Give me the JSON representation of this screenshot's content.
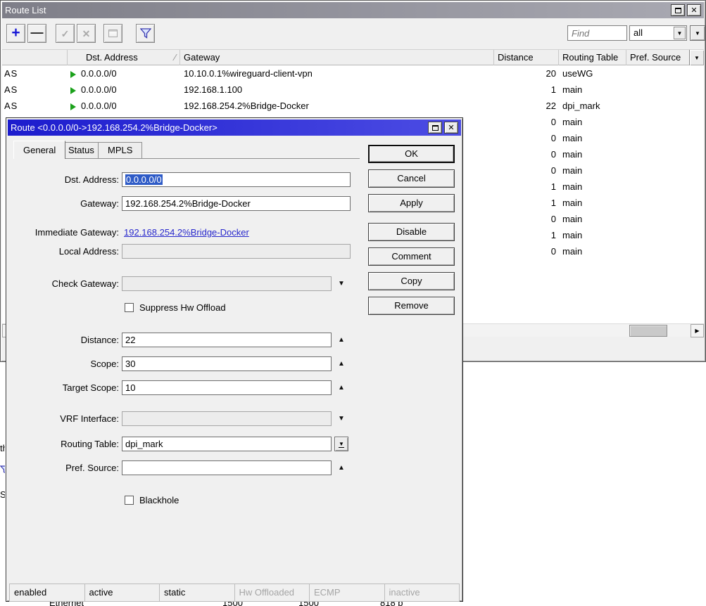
{
  "main_window": {
    "title": "Route List",
    "toolbar": {
      "find_placeholder": "Find",
      "scope_selected": "all"
    },
    "columns": {
      "dst_address": "Dst. Address",
      "gateway": "Gateway",
      "distance": "Distance",
      "routing_table": "Routing Table",
      "pref_source": "Pref. Source"
    },
    "rows": [
      {
        "flags": "AS",
        "dst": "0.0.0.0/0",
        "gateway": "10.10.0.1%wireguard-client-vpn",
        "distance": "20",
        "routing_table": "useWG"
      },
      {
        "flags": "AS",
        "dst": "0.0.0.0/0",
        "gateway": "192.168.1.100",
        "distance": "1",
        "routing_table": "main"
      },
      {
        "flags": "AS",
        "dst": "0.0.0.0/0",
        "gateway": "192.168.254.2%Bridge-Docker",
        "distance": "22",
        "routing_table": "dpi_mark"
      },
      {
        "flags": "",
        "dst": "",
        "gateway": "",
        "distance": "0",
        "routing_table": "main"
      },
      {
        "flags": "",
        "dst": "",
        "gateway": "",
        "distance": "0",
        "routing_table": "main"
      },
      {
        "flags": "",
        "dst": "",
        "gateway": "",
        "distance": "0",
        "routing_table": "main"
      },
      {
        "flags": "",
        "dst": "",
        "gateway": "",
        "distance": "0",
        "routing_table": "main"
      },
      {
        "flags": "",
        "dst": "",
        "gateway": "",
        "distance": "1",
        "routing_table": "main"
      },
      {
        "flags": "",
        "dst": "",
        "gateway": "",
        "distance": "1",
        "routing_table": "main"
      },
      {
        "flags": "",
        "dst": "",
        "gateway": "",
        "distance": "0",
        "routing_table": "main"
      },
      {
        "flags": "",
        "dst": "",
        "gateway": "",
        "distance": "1",
        "routing_table": "main"
      },
      {
        "flags": "",
        "dst": "",
        "gateway": "",
        "distance": "0",
        "routing_table": "main"
      }
    ]
  },
  "dialog": {
    "title": "Route <0.0.0.0/0->192.168.254.2%Bridge-Docker>",
    "tabs": [
      {
        "label": "General"
      },
      {
        "label": "Status"
      },
      {
        "label": "MPLS"
      }
    ],
    "fields": {
      "dst_address": {
        "label": "Dst. Address:",
        "value": "0.0.0.0/0"
      },
      "gateway": {
        "label": "Gateway:",
        "value": "192.168.254.2%Bridge-Docker"
      },
      "immediate_gateway": {
        "label": "Immediate Gateway:",
        "value": "192.168.254.2%Bridge-Docker"
      },
      "local_address": {
        "label": "Local Address:",
        "value": ""
      },
      "check_gateway": {
        "label": "Check Gateway:",
        "value": ""
      },
      "suppress_hw_offload": {
        "label": "Suppress Hw Offload",
        "checked": false
      },
      "distance": {
        "label": "Distance:",
        "value": "22"
      },
      "scope": {
        "label": "Scope:",
        "value": "30"
      },
      "target_scope": {
        "label": "Target Scope:",
        "value": "10"
      },
      "vrf_interface": {
        "label": "VRF Interface:",
        "value": ""
      },
      "routing_table": {
        "label": "Routing Table:",
        "value": "dpi_mark"
      },
      "pref_source": {
        "label": "Pref. Source:",
        "value": ""
      },
      "blackhole": {
        "label": "Blackhole",
        "checked": false
      }
    },
    "buttons": [
      {
        "label": "OK"
      },
      {
        "label": "Cancel"
      },
      {
        "label": "Apply"
      },
      {
        "label": "Disable"
      },
      {
        "label": "Comment"
      },
      {
        "label": "Copy"
      },
      {
        "label": "Remove"
      }
    ],
    "status_flags": [
      {
        "label": "enabled",
        "active": true
      },
      {
        "label": "active",
        "active": true
      },
      {
        "label": "static",
        "active": true
      },
      {
        "label": "Hw Offloaded",
        "active": false
      },
      {
        "label": "ECMP",
        "active": false
      },
      {
        "label": "inactive",
        "active": false
      }
    ]
  },
  "background_fragments": {
    "left_text_1": "th",
    "left_text_2": "S",
    "bottom_text_1": "Ethernet",
    "bottom_num_1": "1500",
    "bottom_num_2": "1500",
    "bottom_text_2": "818 b"
  }
}
